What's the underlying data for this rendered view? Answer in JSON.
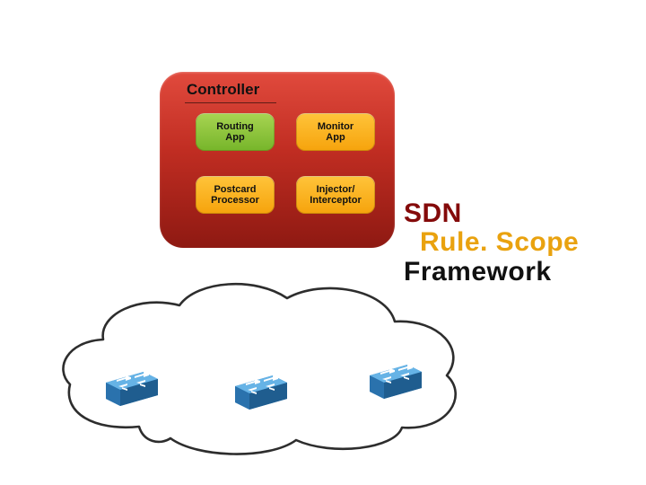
{
  "controller": {
    "title": "Controller",
    "modules": {
      "routing": "Routing\nApp",
      "monitor": "Monitor\nApp",
      "postcard": "Postcard\nProcessor",
      "injector": "Injector/\nInterceptor"
    }
  },
  "title": {
    "line1": "SDN",
    "line2": "Rule. Scope",
    "line3": "Framework"
  }
}
